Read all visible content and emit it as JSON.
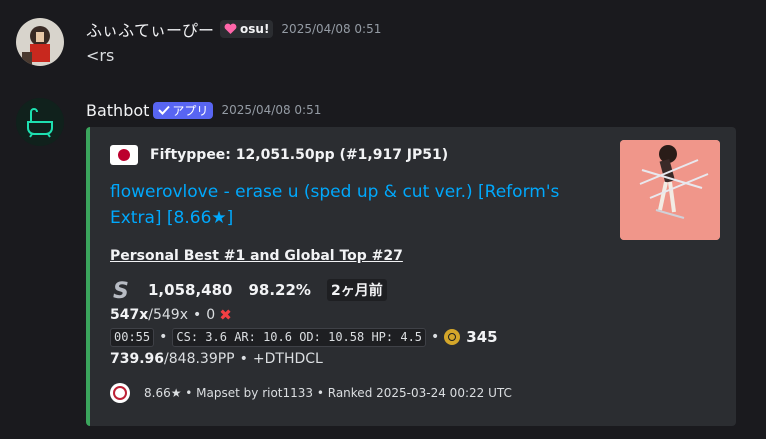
{
  "messages": [
    {
      "username": "ふぃふてぃーぴー",
      "tag": {
        "label": "osu!",
        "icon": "heart-icon"
      },
      "timestamp": "2025/04/08 0:51",
      "content": "<rs"
    },
    {
      "username": "Bathbot",
      "app_badge": {
        "label": "アプリ",
        "icon": "check-icon"
      },
      "timestamp": "2025/04/08 0:51",
      "embed": {
        "accent_color": "#3ba55d",
        "author": "Fiftyppee: 12,051.50pp (#1,917 JP51)",
        "title": "flowerovlove - erase u (sped up & cut ver.) [Reform's Extra] [8.66★]",
        "description": {
          "pb_line": "Personal Best #1 and Global Top #27",
          "grade": "S",
          "score": "1,058,480",
          "accuracy": "98.22%",
          "ago": "2ヶ月前",
          "combo": "547x",
          "max_combo": "/549x",
          "misses": "0",
          "miss_icon": "✖",
          "length": "00:55",
          "map_stats": "CS: 3.6 AR: 10.6 OD: 10.58 HP: 4.5",
          "bpm": "345",
          "pp": "739.96",
          "pp_max": "/848.39PP",
          "mods": "+DTHDCL"
        },
        "footer": "8.66★ • Mapset by riot1133 • Ranked 2025-03-24 00:22 UTC"
      }
    }
  ]
}
